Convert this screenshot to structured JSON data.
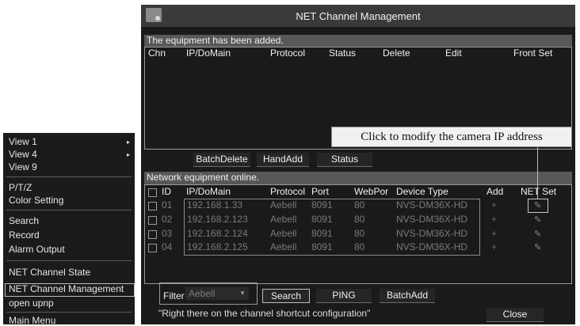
{
  "menu": {
    "items": [
      {
        "label": "View 1",
        "arrow": "▸"
      },
      {
        "label": "View 4",
        "arrow": "▸"
      },
      {
        "label": "View 9"
      },
      {
        "label": "P/T/Z"
      },
      {
        "label": "Color Setting"
      },
      {
        "label": "Search"
      },
      {
        "label": "Record"
      },
      {
        "label": "Alarm Output"
      },
      {
        "label": "NET Channel State"
      },
      {
        "label": "NET Channel Management",
        "selected": true
      },
      {
        "label": "open upnp"
      },
      {
        "label": "Main Menu"
      }
    ]
  },
  "window": {
    "title": "NET Channel Management",
    "added_section": "The equipment has been added.",
    "added_columns": [
      "Chn",
      "IP/DoMain",
      "Protocol",
      "Status",
      "Delete",
      "Edit",
      "Front Set"
    ],
    "buttons": {
      "batch_delete": "BatchDelete",
      "hand_add": "HandAdd",
      "status": "Status"
    },
    "online_section": "Network equipment online.",
    "online_columns": [
      "ID",
      "IP/DoMain",
      "Protocol",
      "Port",
      "WebPor",
      "Device Type",
      "Add",
      "NET Set"
    ],
    "rows": [
      {
        "id": "01",
        "ip": "192.168.1.33",
        "protocol": "Aebell",
        "port": "8091",
        "webport": "80",
        "device": "NVS-DM36X-HD"
      },
      {
        "id": "02",
        "ip": "192.168.2.123",
        "protocol": "Aebell",
        "port": "8091",
        "webport": "80",
        "device": "NVS-DM36X-HD"
      },
      {
        "id": "03",
        "ip": "192.168.2.124",
        "protocol": "Aebell",
        "port": "8091",
        "webport": "80",
        "device": "NVS-DM36X-HD"
      },
      {
        "id": "04",
        "ip": "192.168.2.125",
        "protocol": "Aebell",
        "port": "8091",
        "webport": "80",
        "device": "NVS-DM36X-HD"
      }
    ],
    "add_icon": "+",
    "net_set_icon": "pencil-icon",
    "filter": {
      "label": "Filter",
      "value": "Aebell"
    },
    "bottom_buttons": {
      "search": "Search",
      "ping": "PING",
      "batch_add": "BatchAdd",
      "close": "Close"
    },
    "hint": "\"Right there on the channel shortcut configuration\""
  },
  "callout": "Click to modify the camera IP address"
}
